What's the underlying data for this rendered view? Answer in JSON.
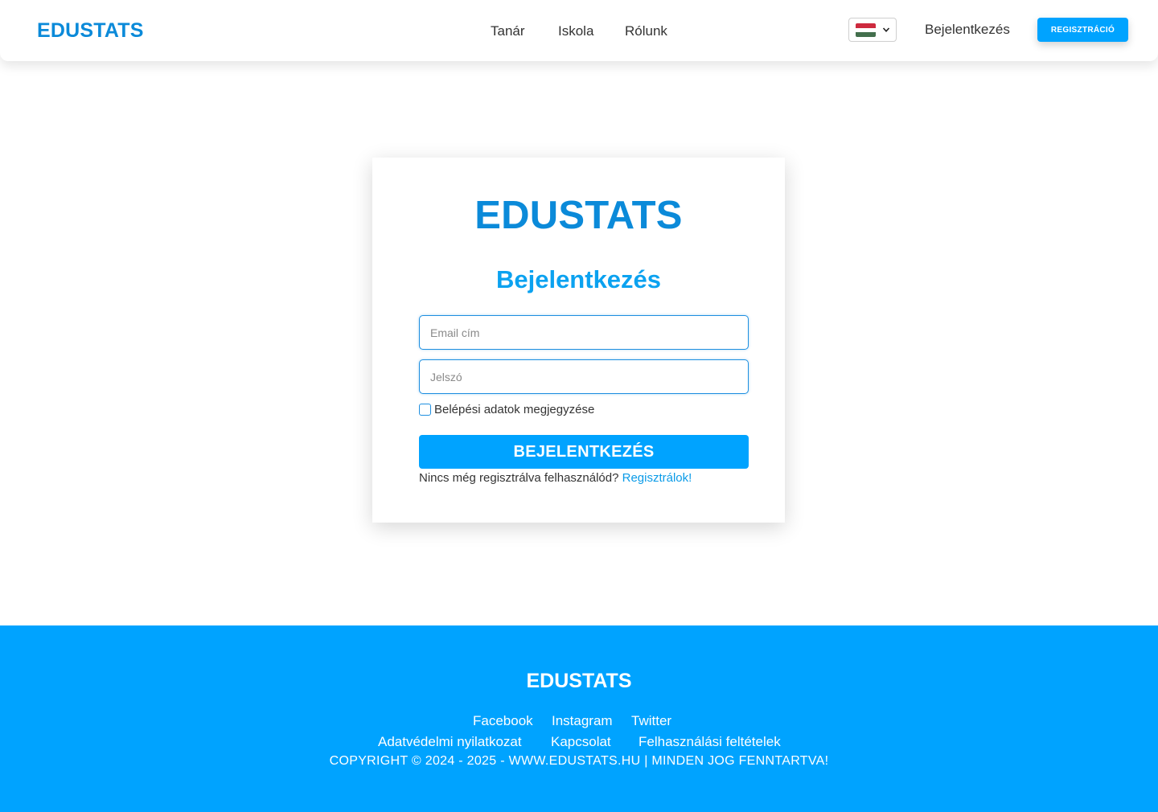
{
  "header": {
    "logo": "EDUSTATS",
    "nav": [
      "Tanár",
      "Iskola",
      "Rólunk"
    ],
    "language": {
      "flag": "hungary-flag-icon",
      "colors": [
        "#cd2a3e",
        "#ffffff",
        "#436f4d"
      ]
    },
    "login_label": "Bejelentkezés",
    "register_label": "REGISZTRÁCIÓ"
  },
  "login_card": {
    "logo": "EDUSTATS",
    "title": "Bejelentkezés",
    "email_placeholder": "Email cím",
    "email_value": "",
    "password_placeholder": "Jelszó",
    "password_value": "",
    "remember_label": "Belépési adatok megjegyzése",
    "remember_checked": false,
    "submit_label": "BEJELENTKEZÉS",
    "no_account_text": "Nincs még regisztrálva felhasználód?",
    "register_link": "Regisztrálok!"
  },
  "footer": {
    "logo": "EDUSTATS",
    "social": [
      "Facebook",
      "Instagram",
      "Twitter"
    ],
    "legal": [
      "Adatvédelmi nyilatkozat",
      "Kapcsolat",
      "Felhasználási feltételek"
    ],
    "copyright": "COPYRIGHT © 2024 - 2025 - WWW.EDUSTATS.HU | MINDEN JOG FENNTARTVA!"
  },
  "colors": {
    "brand": "#0b8ad9",
    "accent": "#00a3ff",
    "footer_bg": "#00a3ff"
  }
}
